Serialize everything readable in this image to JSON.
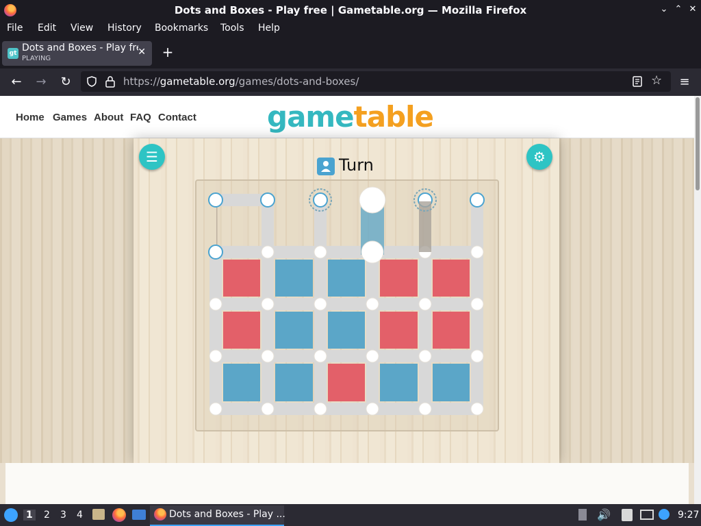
{
  "window": {
    "title": "Dots and Boxes - Play free | Gametable.org — Mozilla Firefox"
  },
  "menu": [
    "File",
    "Edit",
    "View",
    "History",
    "Bookmarks",
    "Tools",
    "Help"
  ],
  "tab": {
    "title": "Dots and Boxes - Play free | Gametable.org",
    "status": "PLAYING",
    "favicon": "gt"
  },
  "url": {
    "prefix": "https://",
    "host": "gametable.org",
    "path": "/games/dots-and-boxes/"
  },
  "site": {
    "nav": [
      "Home",
      "Games",
      "About",
      "FAQ",
      "Contact"
    ],
    "logo": {
      "part1": "game",
      "part2": "table"
    }
  },
  "game": {
    "turn_label": "Turn",
    "scores": {
      "red": "7",
      "blue": "8"
    },
    "colors": {
      "red": "#e36069",
      "blue": "#5ba6c8",
      "line": "#d8d8d8",
      "accent": "#2ec4c4"
    },
    "boxes": [
      [
        "red",
        "blue",
        "blue",
        "red",
        "red"
      ],
      [
        "red",
        "blue",
        "blue",
        "red",
        "red"
      ],
      [
        "blue",
        "blue",
        "red",
        "blue",
        "blue"
      ]
    ]
  },
  "taskbar": {
    "workspaces": [
      "1",
      "2",
      "3",
      "4"
    ],
    "task": "Dots and Boxes - Play ...",
    "clock": "9:27"
  }
}
